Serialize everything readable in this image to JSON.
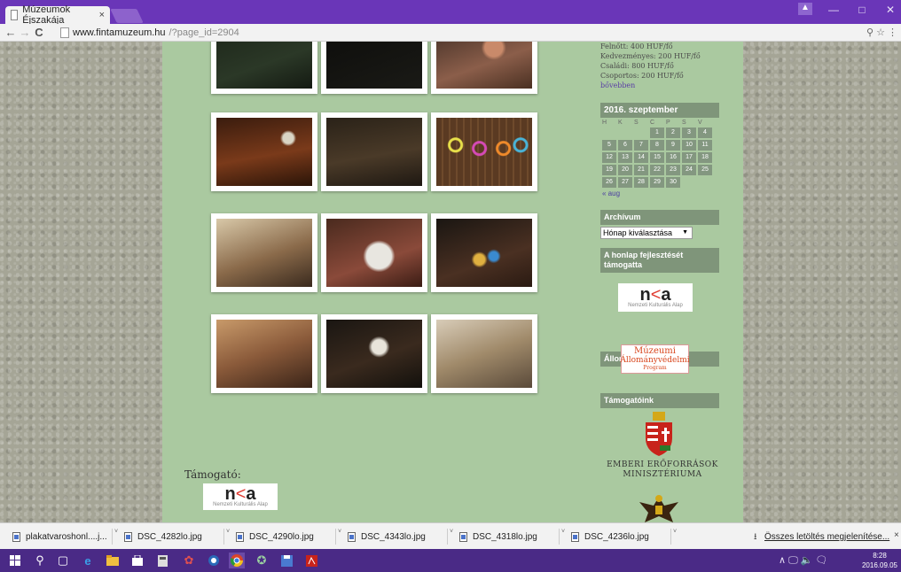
{
  "browser": {
    "tab_title": "Múzeumok Éjszakája",
    "tab_close": "×",
    "win_min": "—",
    "win_max": "□",
    "win_close": "✕",
    "url_domain": "www.fintamuzeum.hu",
    "url_path": "/?page_id=2904",
    "addr_icons": "⚲ ☆ ⋮",
    "user_icon": "▲"
  },
  "sidebar": {
    "prices": [
      "Felnőtt: 400 HUF/fő",
      "Kedvezményes: 200 HUF/fő",
      "Családi: 800 HUF/fő",
      "Csoportos: 200 HUF/fő"
    ],
    "more_link": "bővebben",
    "calendar": {
      "title": "2016. szeptember",
      "days": [
        "H",
        "K",
        "S",
        "C",
        "P",
        "S",
        "V"
      ],
      "weeks": [
        [
          "",
          "",
          "",
          "1",
          "2",
          "3",
          "4"
        ],
        [
          "5",
          "6",
          "7",
          "8",
          "9",
          "10",
          "11"
        ],
        [
          "12",
          "13",
          "14",
          "15",
          "16",
          "17",
          "18"
        ],
        [
          "19",
          "20",
          "21",
          "22",
          "23",
          "24",
          "25"
        ],
        [
          "26",
          "27",
          "28",
          "29",
          "30",
          "",
          ""
        ]
      ],
      "prev_link": "« aug"
    },
    "archive": {
      "title": "Archívum",
      "select_value": "Hónap kiválasztása"
    },
    "support": {
      "title": "A honlap fejlesztését támogatta"
    },
    "allomany": {
      "title": "Állományvédelem",
      "line1": "Múzeumi",
      "line2": "Állományvédelmi",
      "line3": "Program"
    },
    "partners": {
      "title": "Támogatóink",
      "emmi_line1": "EMBERI ERŐFORRÁSOK",
      "emmi_line2": "MINISZTÉRIUMA"
    }
  },
  "nka": {
    "logo_n": "n",
    "logo_k": "<",
    "logo_a": "a",
    "sub": "Nemzeti Kulturális Alap"
  },
  "main": {
    "support_label": "Támogató:"
  },
  "downloads": {
    "items": [
      "plakatvaroshonl....j...",
      "DSC_4282lo.jpg",
      "DSC_4290lo.jpg",
      "DSC_4343lo.jpg",
      "DSC_4318lo.jpg",
      "DSC_4236lo.jpg"
    ],
    "show_all": "Összes letöltés megjelenítése...",
    "close": "×"
  },
  "taskbar": {
    "time": "8:28",
    "date": "2016.09.05",
    "tray": "∧ 🖵 🔈 🗨"
  },
  "colors": {
    "content_bg": "#aac9a0",
    "widget_title_bg": "#7f957a",
    "calendar_cell": "#839780",
    "taskbar": "#4a2a86"
  }
}
